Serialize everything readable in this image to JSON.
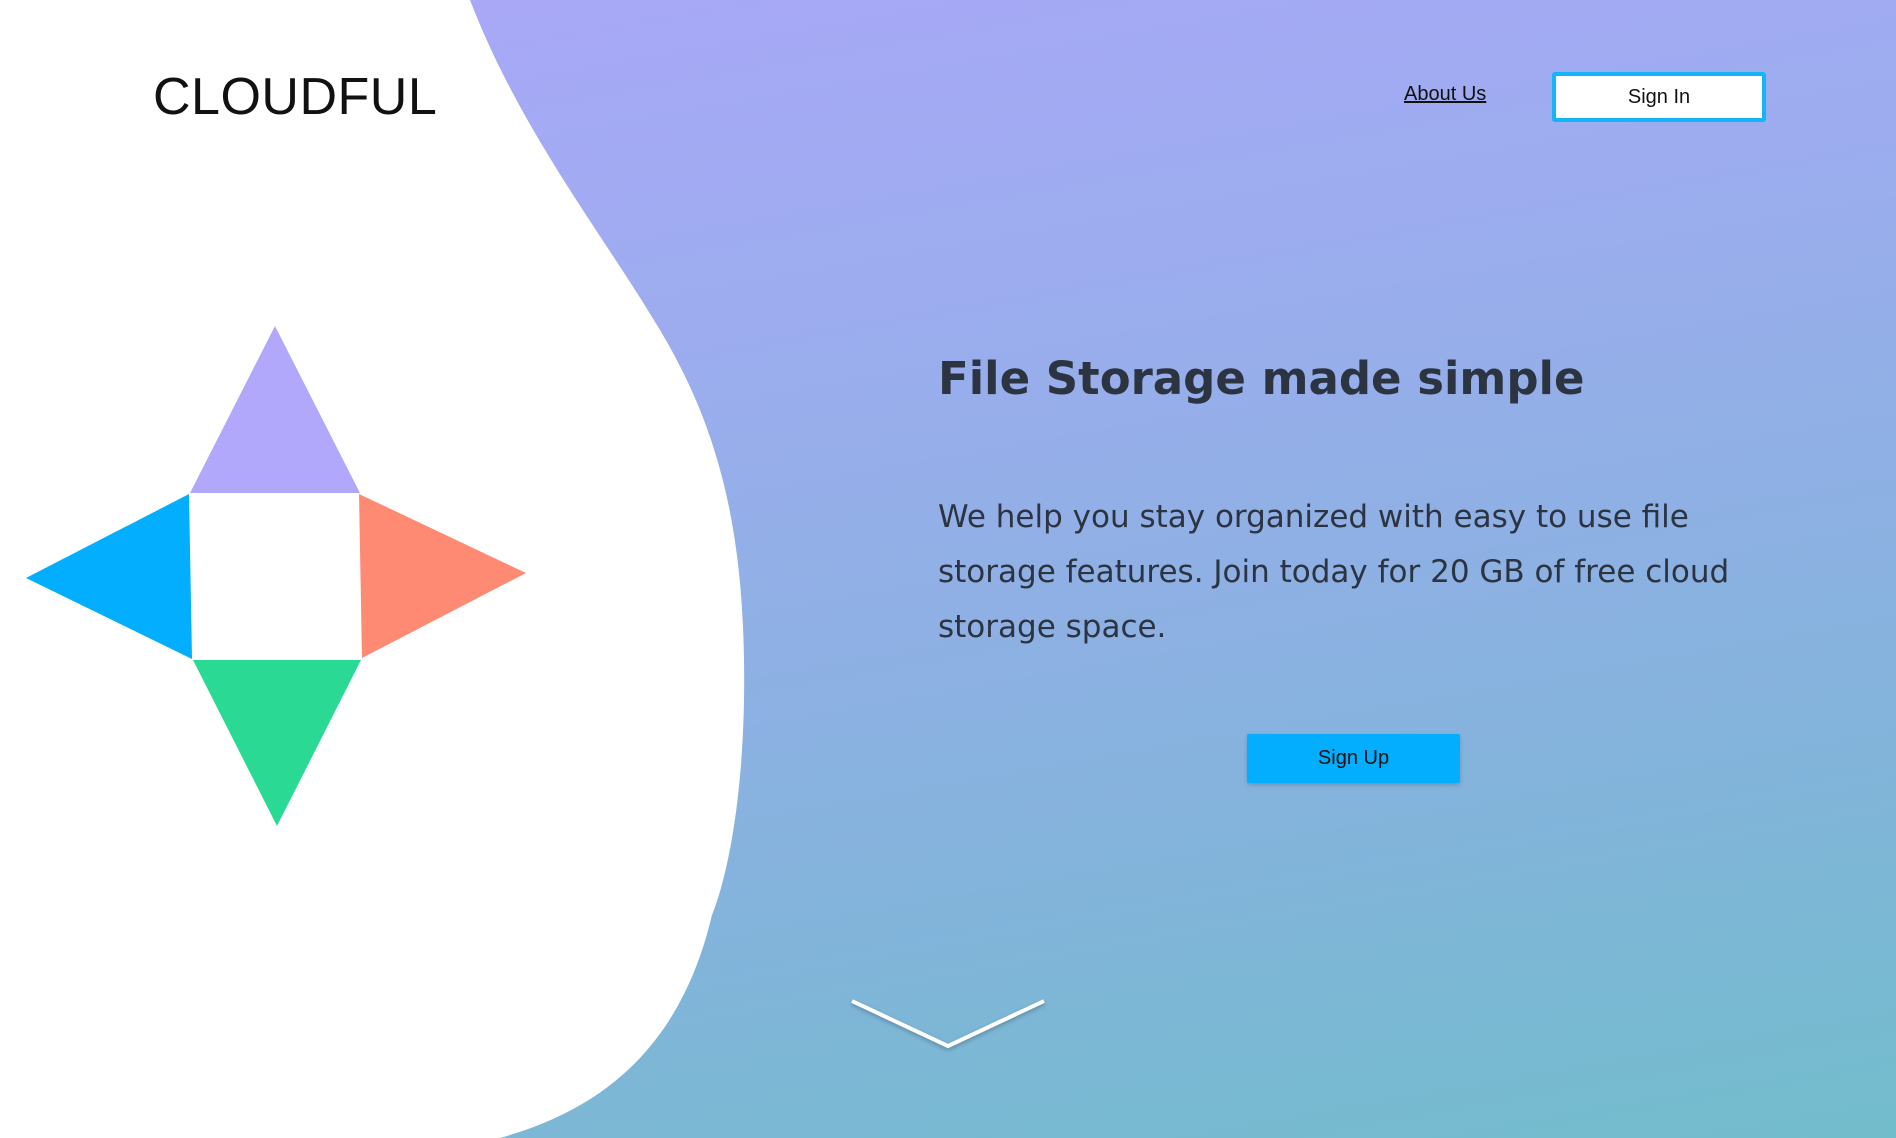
{
  "header": {
    "logo_light": "CLOUD",
    "logo_bold": "FUL",
    "about_label": "About Us",
    "signin_label": "Sign In"
  },
  "hero": {
    "headline": "File Storage made simple",
    "tagline": "We help you stay organized with easy to use file storage features. Join today for 20 GB of free cloud storage space.",
    "signup_label": "Sign Up"
  },
  "colors": {
    "accent": "#02aefd",
    "star_top": "#b2a8fb",
    "star_right": "#ff8a73",
    "star_bottom": "#2ad994",
    "star_left": "#02aefd",
    "text_dark": "#2c3442"
  },
  "icons": {
    "logo_mark": "four-point-star-icon",
    "scroll": "chevron-down-icon"
  }
}
